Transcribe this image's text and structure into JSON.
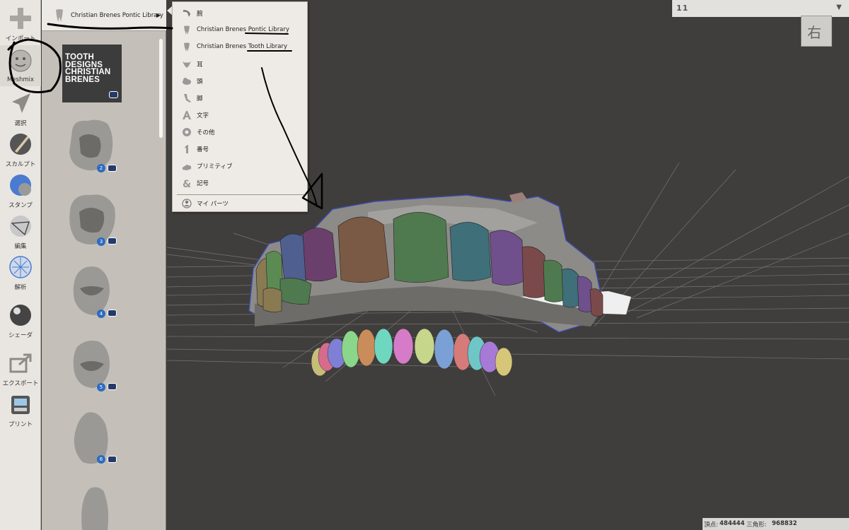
{
  "toolbar": {
    "tools": [
      {
        "label": "インポート",
        "icon": "plus-icon"
      },
      {
        "label": "Meshmix",
        "icon": "meshmix-icon"
      },
      {
        "label": "選択",
        "icon": "select-arrow-icon"
      },
      {
        "label": "スカルプト",
        "icon": "sculpt-brush-icon"
      },
      {
        "label": "スタンプ",
        "icon": "stamp-icon"
      },
      {
        "label": "編集",
        "icon": "edit-icon"
      },
      {
        "label": "解析",
        "icon": "analysis-icon"
      },
      {
        "label": "シェーダ",
        "icon": "shader-sphere-icon"
      },
      {
        "label": "エクスポート",
        "icon": "export-icon"
      },
      {
        "label": "プリント",
        "icon": "print-icon"
      }
    ]
  },
  "library": {
    "dropdown_label": "Christian Brenes Pontic Library",
    "logo_text": "TOOTH\nDESIGNS\nCHRISTIAN\nBRENES",
    "items": [
      {
        "number": "2"
      },
      {
        "number": "3"
      },
      {
        "number": "4"
      },
      {
        "number": "5"
      },
      {
        "number": "6"
      },
      {
        "number": ""
      }
    ]
  },
  "popup_menu": {
    "items": [
      {
        "label": "腕",
        "icon": "arm-icon"
      },
      {
        "label": "Christian Brenes Pontic Library",
        "icon": "tooth-icon"
      },
      {
        "label": "Christian Brenes Tooth Library",
        "icon": "tooth-icon"
      },
      {
        "label": "耳",
        "icon": "ear-icon"
      },
      {
        "label": "頭",
        "icon": "head-icon"
      },
      {
        "label": "脚",
        "icon": "leg-icon"
      },
      {
        "label": "文字",
        "icon": "letter-a-icon"
      },
      {
        "label": "その他",
        "icon": "misc-icon"
      },
      {
        "label": "番号",
        "icon": "number-icon"
      },
      {
        "label": "プリミティブ",
        "icon": "primitive-icon"
      },
      {
        "label": "記号",
        "icon": "symbol-icon"
      },
      {
        "label": "マイ パーツ",
        "icon": "my-parts-icon"
      }
    ]
  },
  "layer_select": {
    "value": "11"
  },
  "view_cube": {
    "label": "右"
  },
  "status": {
    "vertices_label": "頂点:",
    "vertices_value": "484444",
    "triangles_label": "三角形:",
    "triangles_value": "968832"
  },
  "colors": {
    "background": "#3f3e3c",
    "toolbar": "#e9e6e1",
    "panel": "#c4c0b9",
    "menu": "#eeebe6",
    "badge": "#2d6bc0"
  }
}
